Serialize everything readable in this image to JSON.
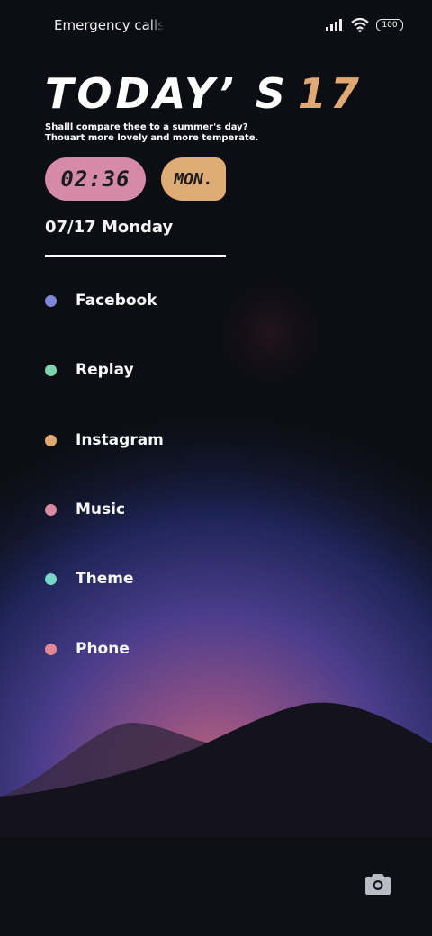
{
  "status_bar": {
    "carrier_text": "Emergency calls o",
    "battery": "100",
    "icons": [
      "signal-icon",
      "wifi-icon",
      "battery-icon"
    ]
  },
  "widget": {
    "headline_text": "TODAY’ S",
    "headline_number": "17",
    "quote_line1": "Shalll compare thee to a summer's day?",
    "quote_line2": "Thouart more lovely and more temperate.",
    "time": "02:36",
    "day_short": "MON.",
    "date": "07/17 Monday"
  },
  "apps": [
    {
      "label": "Facebook",
      "color": "#7f86d6"
    },
    {
      "label": "Replay",
      "color": "#7dd3b0"
    },
    {
      "label": "Instagram",
      "color": "#e0a873"
    },
    {
      "label": "Music",
      "color": "#d98aa3"
    },
    {
      "label": "Theme",
      "color": "#79d6c4"
    },
    {
      "label": "Phone",
      "color": "#e08896"
    }
  ],
  "colors": {
    "accent_orange": "#e0a873",
    "time_pill": "#d58aa7",
    "day_pill": "#dfac77",
    "background": "#0c0e13"
  },
  "bottom": {
    "camera": "camera-icon"
  }
}
